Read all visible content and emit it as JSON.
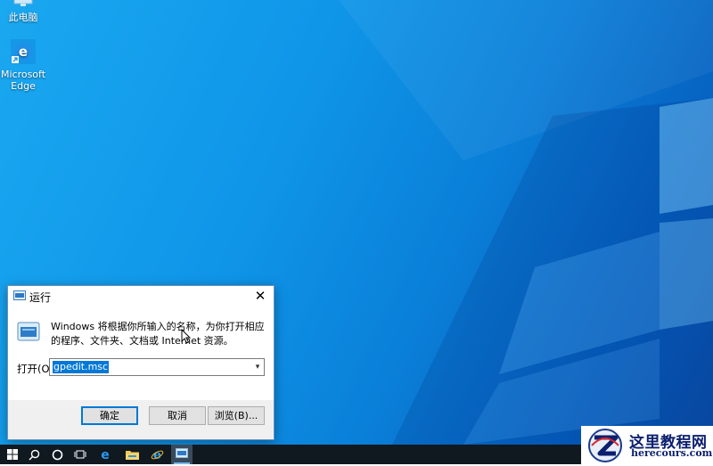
{
  "desktop": {
    "icons": [
      {
        "label": "此电脑",
        "icon": "this-pc-icon"
      },
      {
        "label": "Microsoft Edge",
        "icon": "edge-icon"
      }
    ]
  },
  "run_dialog": {
    "title": "运行",
    "description": "Windows 将根据你所输入的名称，为你打开相应的程序、文件夹、文档或 Internet 资源。",
    "open_label": "打开(O):",
    "open_value": "gpedit.msc",
    "ok_label": "确定",
    "cancel_label": "取消",
    "browse_label": "浏览(B)...",
    "close_symbol": "✕"
  },
  "taskbar": {
    "items": [
      "windows-start-icon",
      "search-icon",
      "cortana-icon",
      "task-view-icon",
      "edge-icon",
      "file-explorer-icon",
      "ie-icon",
      "run-icon"
    ]
  },
  "watermark": {
    "title": "这里教程网",
    "url": "herecours.com"
  },
  "colors": {
    "accent": "#0078d7",
    "desktop": "#0f95e8",
    "taskbar": "#101820"
  }
}
